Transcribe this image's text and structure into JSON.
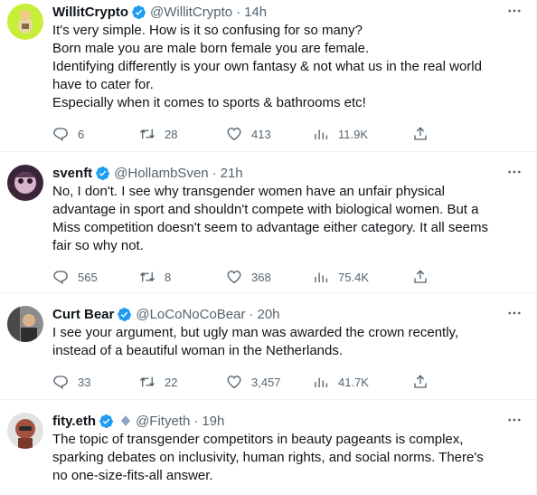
{
  "tweets": [
    {
      "name": "WillitCrypto",
      "handle": "@WillitCrypto",
      "dot": "·",
      "time": "14h",
      "text": "It's very simple. How is it so confusing for so many?\nBorn male you are male born female you are female.\nIdentifying differently is your own fantasy & not what us in the real world have to cater for.\nEspecially when it comes to sports & bathrooms etc!",
      "replies": "6",
      "retweets": "28",
      "likes": "413",
      "views": "11.9K"
    },
    {
      "name": "svenft",
      "handle": "@HollambSven",
      "dot": "·",
      "time": "21h",
      "text": "No, I don't. I see why transgender women have an unfair physical advantage in sport and shouldn't compete with biological women. But a Miss competition doesn't seem to advantage either category. It all seems fair so why not.",
      "replies": "565",
      "retweets": "8",
      "likes": "368",
      "views": "75.4K"
    },
    {
      "name": "Curt Bear",
      "handle": "@LoCoNoCoBear",
      "dot": "·",
      "time": "20h",
      "text": "I see your argument, but ugly man was awarded the crown recently, instead of a beautiful woman in the Netherlands.",
      "replies": "33",
      "retweets": "22",
      "likes": "3,457",
      "views": "41.7K"
    },
    {
      "name": "fity.eth",
      "handle": "@Fityeth",
      "dot": "·",
      "time": "19h",
      "text": "The topic of transgender competitors in beauty pageants is complex, sparking debates on inclusivity, human rights, and social norms. There's no one-size-fits-all answer."
    }
  ],
  "icons": {
    "verified": "verified-badge-icon",
    "more": "more-options-icon",
    "reply": "reply-icon",
    "retweet": "retweet-icon",
    "like": "like-icon",
    "views": "views-icon",
    "share": "share-icon"
  },
  "colors": {
    "verified_blue": "#1d9bf0",
    "muted_text": "#536471",
    "body_text": "#0f1419",
    "divider": "#eff3f4"
  }
}
